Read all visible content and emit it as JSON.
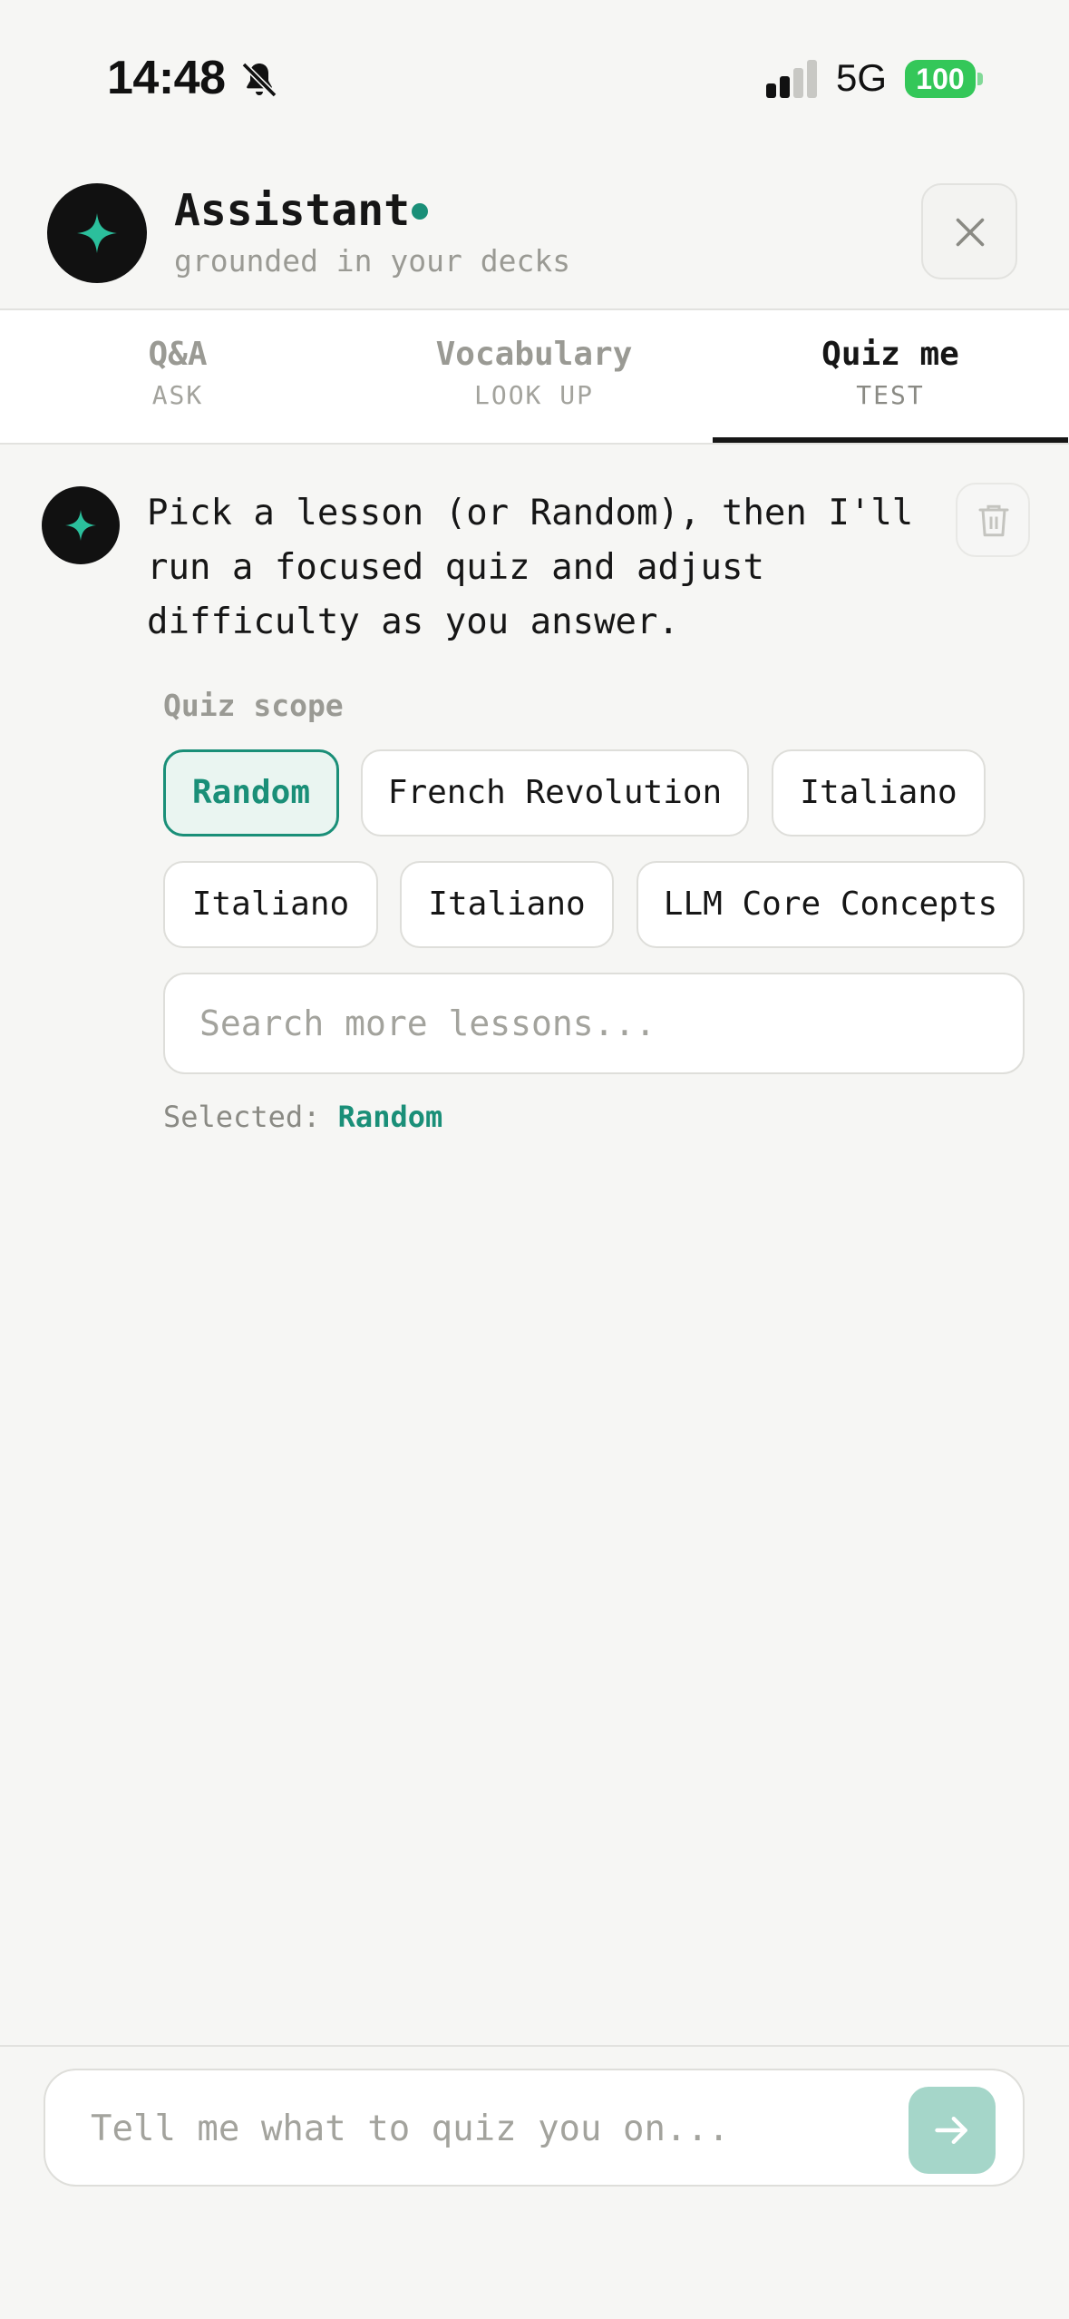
{
  "status_bar": {
    "time": "14:48",
    "network": "5G",
    "battery": "100"
  },
  "header": {
    "title": "Assistant",
    "subtitle": "grounded in your decks"
  },
  "tabs": [
    {
      "label": "Q&A",
      "sub": "ASK"
    },
    {
      "label": "Vocabulary",
      "sub": "LOOK UP"
    },
    {
      "label": "Quiz me",
      "sub": "TEST"
    }
  ],
  "active_tab": "Quiz me",
  "message": {
    "text": "Pick a lesson (or Random), then I'll run a focused quiz and adjust difficulty as you answer."
  },
  "quiz_scope": {
    "label": "Quiz scope",
    "chips": [
      {
        "label": "Random",
        "selected": true
      },
      {
        "label": "French Revolution",
        "selected": false
      },
      {
        "label": "Italiano",
        "selected": false
      },
      {
        "label": "Italiano",
        "selected": false
      },
      {
        "label": "Italiano",
        "selected": false
      },
      {
        "label": "LLM Core Concepts",
        "selected": false
      }
    ],
    "search_placeholder": "Search more lessons...",
    "selected_prefix": "Selected:",
    "selected_value": "Random"
  },
  "composer": {
    "placeholder": "Tell me what to quiz you on..."
  },
  "colors": {
    "accent": "#1a8f78",
    "send_button": "#a5d6c9",
    "battery": "#34c759"
  }
}
